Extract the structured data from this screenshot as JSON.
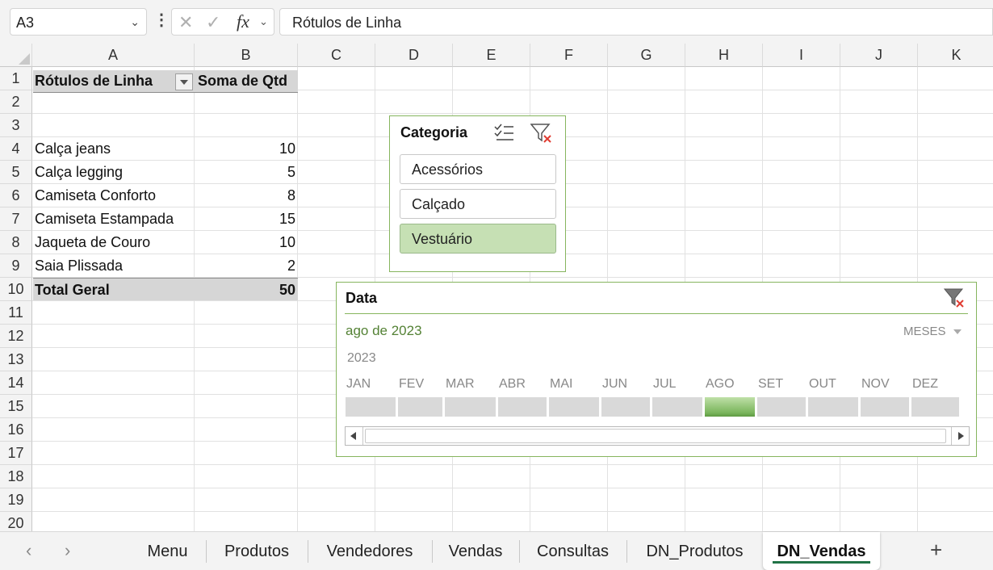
{
  "formula_bar": {
    "name_box": "A3",
    "fx_label": "fx",
    "formula": "Rótulos de Linha"
  },
  "columns": [
    "A",
    "B",
    "C",
    "D",
    "E",
    "F",
    "G",
    "H",
    "I",
    "J",
    "K"
  ],
  "rows": [
    "1",
    "2",
    "3",
    "4",
    "5",
    "6",
    "7",
    "8",
    "9",
    "10",
    "11",
    "12",
    "13",
    "14",
    "15",
    "16",
    "17",
    "18",
    "19",
    "20"
  ],
  "pivot": {
    "header_row_label": "Rótulos de Linha",
    "header_value_label": "Soma de Qtd",
    "rows": [
      {
        "label": "Calça jeans",
        "value": "10"
      },
      {
        "label": "Calça legging",
        "value": "5"
      },
      {
        "label": "Camiseta Conforto",
        "value": "8"
      },
      {
        "label": "Camiseta Estampada",
        "value": "15"
      },
      {
        "label": "Jaqueta de Couro",
        "value": "10"
      },
      {
        "label": "Saia Plissada",
        "value": "2"
      }
    ],
    "total_label": "Total Geral",
    "total_value": "50"
  },
  "slicer_categoria": {
    "title": "Categoria",
    "items": [
      {
        "label": "Acessórios",
        "selected": false
      },
      {
        "label": "Calçado",
        "selected": false
      },
      {
        "label": "Vestuário",
        "selected": true
      }
    ],
    "selected_color": "#c6e0b4"
  },
  "timeline": {
    "title": "Data",
    "period": "ago de 2023",
    "level": "MESES",
    "year": "2023",
    "months": [
      "JAN",
      "FEV",
      "MAR",
      "ABR",
      "MAI",
      "JUN",
      "JUL",
      "AGO",
      "SET",
      "OUT",
      "NOV",
      "DEZ"
    ],
    "selected_month": "AGO",
    "accent_color": "#548235"
  },
  "sheet_tabs": {
    "tabs": [
      "Menu",
      "Produtos",
      "Vendedores",
      "Vendas",
      "Consultas",
      "DN_Produtos",
      "DN_Vendas"
    ],
    "active": "DN_Vendas",
    "add_label": "+"
  }
}
